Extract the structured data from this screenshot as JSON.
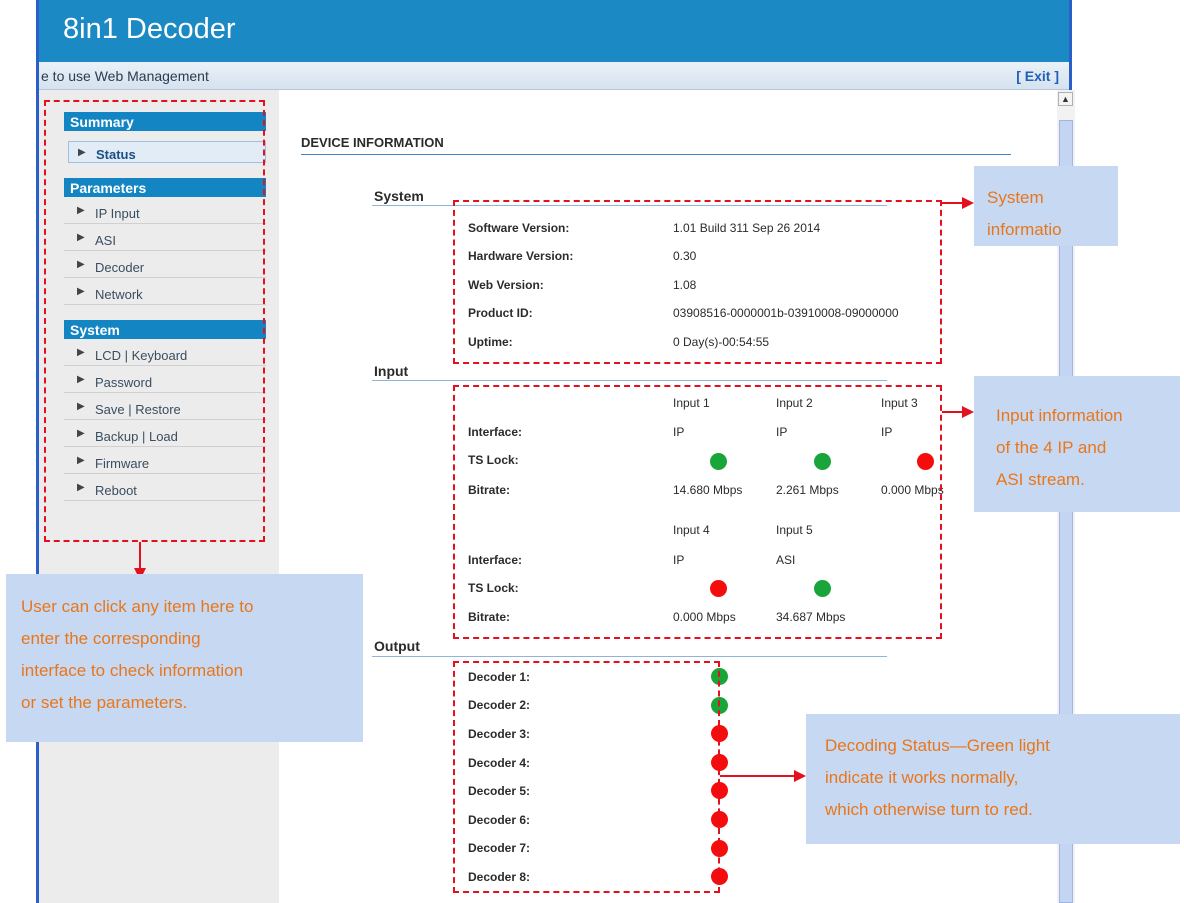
{
  "header": {
    "title": "8in1 Decoder",
    "welcome": "e to use Web Management",
    "exit_label": "[ Exit ]"
  },
  "sidebar": {
    "groups": [
      {
        "title": "Summary",
        "items": [
          {
            "label": "Status"
          }
        ]
      },
      {
        "title": "Parameters",
        "items": [
          {
            "label": "IP Input"
          },
          {
            "label": "ASI"
          },
          {
            "label": "Decoder"
          },
          {
            "label": "Network"
          }
        ]
      },
      {
        "title": "System",
        "items": [
          {
            "label": "LCD | Keyboard"
          },
          {
            "label": "Password"
          },
          {
            "label": "Save | Restore"
          },
          {
            "label": "Backup | Load"
          },
          {
            "label": "Firmware"
          },
          {
            "label": "Reboot"
          }
        ]
      }
    ]
  },
  "main": {
    "title": "DEVICE INFORMATION",
    "system": {
      "heading": "System",
      "rows": [
        {
          "label": "Software Version:",
          "value": "1.01 Build 311 Sep 26 2014"
        },
        {
          "label": "Hardware Version:",
          "value": "0.30"
        },
        {
          "label": "Web Version:",
          "value": "1.08"
        },
        {
          "label": "Product ID:",
          "value": "03908516-0000001b-03910008-09000000"
        },
        {
          "label": "Uptime:",
          "value": "0 Day(s)-00:54:55"
        }
      ]
    },
    "input": {
      "heading": "Input",
      "row_labels": {
        "interface": "Interface:",
        "ts_lock": "TS Lock:",
        "bitrate": "Bitrate:"
      },
      "inputs": [
        {
          "name": "Input 1",
          "interface": "IP",
          "ts_lock": "green",
          "bitrate": "14.680 Mbps"
        },
        {
          "name": "Input 2",
          "interface": "IP",
          "ts_lock": "green",
          "bitrate": "2.261 Mbps"
        },
        {
          "name": "Input 3",
          "interface": "IP",
          "ts_lock": "red",
          "bitrate": "0.000 Mbps"
        },
        {
          "name": "Input 4",
          "interface": "IP",
          "ts_lock": "red",
          "bitrate": "0.000 Mbps"
        },
        {
          "name": "Input 5",
          "interface": "ASI",
          "ts_lock": "green",
          "bitrate": "34.687 Mbps"
        }
      ]
    },
    "output": {
      "heading": "Output",
      "decoders": [
        {
          "label": "Decoder 1:",
          "status": "green"
        },
        {
          "label": "Decoder 2:",
          "status": "green"
        },
        {
          "label": "Decoder 3:",
          "status": "red"
        },
        {
          "label": "Decoder 4:",
          "status": "red"
        },
        {
          "label": "Decoder 5:",
          "status": "red"
        },
        {
          "label": "Decoder 6:",
          "status": "red"
        },
        {
          "label": "Decoder 7:",
          "status": "red"
        },
        {
          "label": "Decoder 8:",
          "status": "red"
        }
      ]
    }
  },
  "annotations": {
    "system": [
      "System",
      "informatio"
    ],
    "input": [
      "Input information",
      "of the 4 IP and",
      "ASI stream."
    ],
    "sidebar": [
      "User can click any item here to",
      "enter the corresponding",
      "interface to check information",
      "or set the parameters."
    ],
    "output": [
      "Decoding Status—Green light",
      "indicate it works normally,",
      "which otherwise turn to red."
    ]
  },
  "colors": {
    "header": "#1a89c4",
    "status_green": "#1aa53a",
    "status_red": "#f50d0d",
    "annotation_red": "#e5101d",
    "callout_bg": "#c7d9f2",
    "callout_text": "#e8761b"
  },
  "icons": {
    "menu_arrow": "triangle-right-icon",
    "scroll_up": "chevron-up-icon"
  }
}
